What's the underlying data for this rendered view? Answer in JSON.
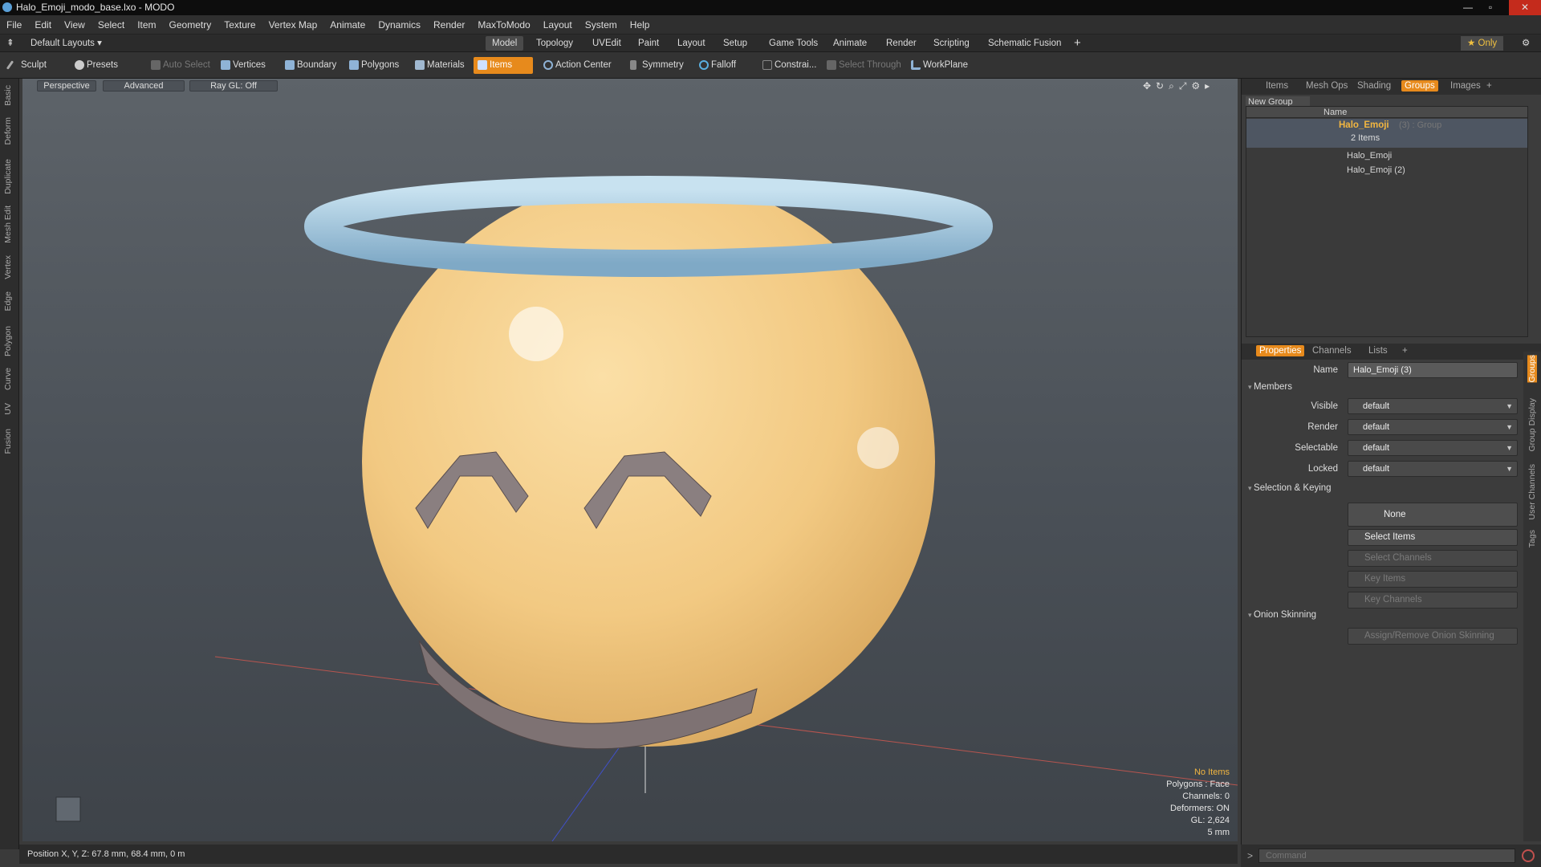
{
  "window": {
    "title": "Halo_Emoji_modo_base.lxo - MODO",
    "controls": [
      "—",
      "▫",
      "✕"
    ]
  },
  "menu": [
    "File",
    "Edit",
    "View",
    "Select",
    "Item",
    "Geometry",
    "Texture",
    "Vertex Map",
    "Animate",
    "Dynamics",
    "Render",
    "MaxToModo",
    "Layout",
    "System",
    "Help"
  ],
  "layouts": {
    "preset": "Default Layouts ▾",
    "tabs": [
      "Model",
      "Topology",
      "UVEdit",
      "Paint",
      "Layout",
      "Setup",
      "Game Tools",
      "Animate",
      "Render",
      "Scripting",
      "Schematic Fusion"
    ],
    "active": "Model",
    "add": "+",
    "only": "★ Only"
  },
  "toolbar": {
    "sculpt": "Sculpt",
    "presets": "Presets",
    "auto_select": "Auto Select",
    "vertices": "Vertices",
    "boundary": "Boundary",
    "polygons": "Polygons",
    "materials": "Materials",
    "items": "Items",
    "action_center": "Action Center",
    "symmetry": "Symmetry",
    "falloff": "Falloff",
    "constraint": "Constrai...",
    "select_through": "Select Through",
    "workplane": "WorkPlane"
  },
  "left_tabs": [
    "Basic",
    "Deform",
    "Duplicate",
    "Mesh Edit",
    "Vertex",
    "Edge",
    "Polygon",
    "Curve",
    "UV",
    "Fusion"
  ],
  "viewport": {
    "perspective": "Perspective",
    "advanced": "Advanced",
    "raygl": "Ray GL: Off",
    "info": [
      "No Items",
      "Polygons : Face",
      "Channels: 0",
      "Deformers: ON",
      "GL: 2,624",
      "5 mm"
    ]
  },
  "status": "Position X, Y, Z:  67.8 mm, 68.4 mm, 0 m",
  "top_panel": {
    "tabs": [
      "Items",
      "Mesh Ops",
      "Shading",
      "Groups",
      "Images",
      "+"
    ],
    "active": "Groups",
    "new_group": "New Group",
    "col_name": "Name",
    "group_name": "Halo_Emoji",
    "group_suffix": " (3) : Group",
    "item_count": "2 Items",
    "children": [
      "Halo_Emoji",
      "Halo_Emoji (2)"
    ]
  },
  "props": {
    "tabs": [
      "Properties",
      "Channels",
      "Lists",
      "+"
    ],
    "active": "Properties",
    "name_label": "Name",
    "name_value": "Halo_Emoji (3)",
    "members": "Members",
    "visible_label": "Visible",
    "visible": "default",
    "render_label": "Render",
    "render": "default",
    "selectable_label": "Selectable",
    "selectable": "default",
    "locked_label": "Locked",
    "locked": "default",
    "selkey": "Selection & Keying",
    "none": "None",
    "select_items": "Select Items",
    "select_channels": "Select Channels",
    "key_items": "Key Items",
    "key_channels": "Key Channels",
    "onion": "Onion Skinning",
    "assign_onion": "Assign/Remove Onion Skinning"
  },
  "side_tabs": [
    "Groups",
    "Group Display",
    "User Channels",
    "Tags"
  ],
  "command": {
    "prompt": ">",
    "placeholder": "Command"
  },
  "colors": {
    "accent": "#e78a1c",
    "face": "#f2c982",
    "halo": "#a9cde3"
  }
}
